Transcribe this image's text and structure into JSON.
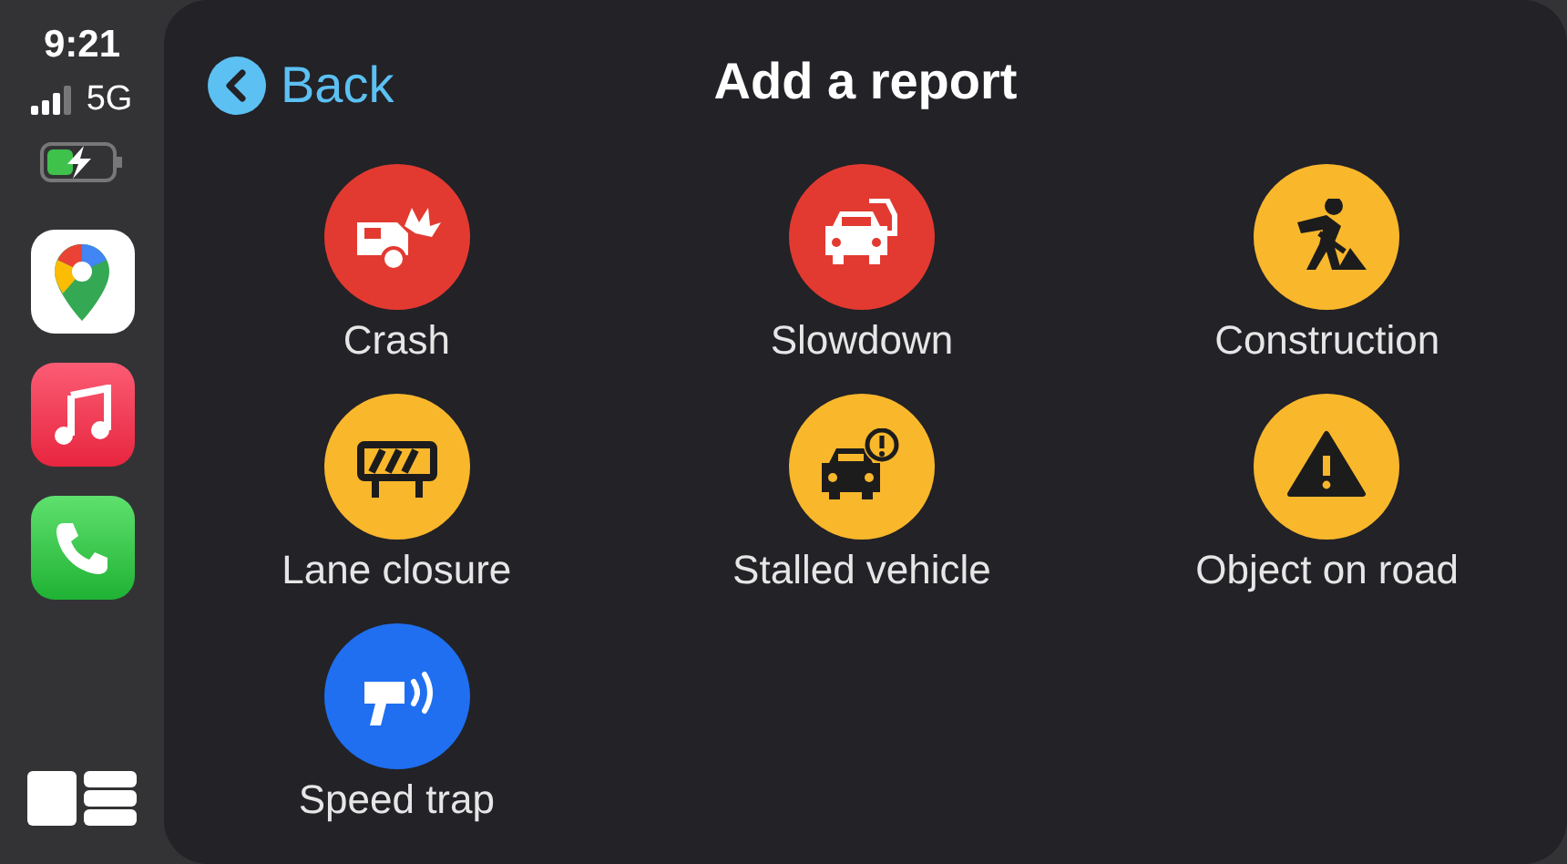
{
  "status": {
    "time": "9:21",
    "network": "5G"
  },
  "header": {
    "back": "Back",
    "title": "Add a report"
  },
  "reports": [
    {
      "label": "Crash",
      "kind": "crash",
      "color": "#e23a31"
    },
    {
      "label": "Slowdown",
      "kind": "slowdown",
      "color": "#e23a31"
    },
    {
      "label": "Construction",
      "kind": "construction",
      "color": "#f9b72c"
    },
    {
      "label": "Lane closure",
      "kind": "closure",
      "color": "#f9b72c"
    },
    {
      "label": "Stalled vehicle",
      "kind": "stalled",
      "color": "#f9b72c"
    },
    {
      "label": "Object on road",
      "kind": "hazard",
      "color": "#f9b72c"
    },
    {
      "label": "Speed trap",
      "kind": "speedtrap",
      "color": "#1f6ff0"
    }
  ]
}
